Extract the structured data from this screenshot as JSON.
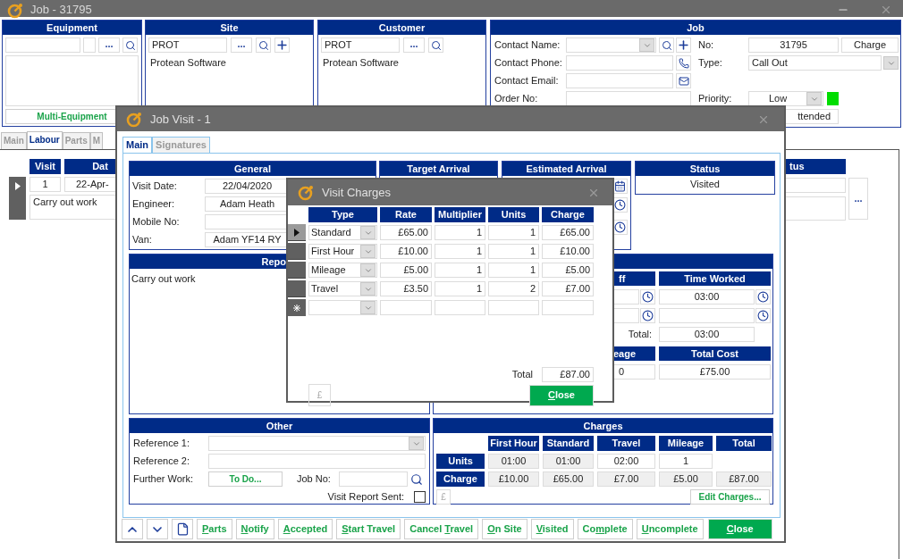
{
  "job_window": {
    "title": "Job - 31795",
    "equipment": {
      "title": "Equipment",
      "more_button": "...",
      "multi_button": "Multi-Equipment"
    },
    "site": {
      "title": "Site",
      "code": "PROT",
      "more_button": "...",
      "name": "Protean Software"
    },
    "customer": {
      "title": "Customer",
      "code": "PROT",
      "more_button": "...",
      "name": "Protean Software"
    },
    "job": {
      "title": "Job",
      "contact_name_label": "Contact Name:",
      "contact_phone_label": "Contact Phone:",
      "contact_email_label": "Contact Email:",
      "order_no_label": "Order No:",
      "no_label": "No:",
      "no": "31795",
      "charge_button": "Charge",
      "type_label": "Type:",
      "type": "Call Out",
      "priority_label": "Priority:",
      "priority": {
        "value": "Low",
        "color": "#00dd00"
      },
      "status": "ttended"
    },
    "tabs": [
      {
        "label": "Main",
        "selected": false
      },
      {
        "label": "Labour",
        "selected": true
      },
      {
        "label": "Parts",
        "selected": false
      },
      {
        "label": "M",
        "selected": false
      }
    ],
    "labour_grid": {
      "columns": [
        "Visit",
        "Dat"
      ],
      "rows": [
        {
          "visit": "1",
          "date": "22-Apr-",
          "description": "Carry out work",
          "selected": true
        }
      ],
      "right_header": "tus",
      "more_button": "..."
    }
  },
  "job_visit": {
    "title": "Job Visit - 1",
    "tabs": [
      {
        "label": "Main",
        "selected": true
      },
      {
        "label": "Signatures",
        "selected": false
      }
    ],
    "general": {
      "title": "General",
      "rows": [
        {
          "label": "Visit Date:",
          "value": "22/04/2020"
        },
        {
          "label": "Engineer:",
          "value": "Adam Heath"
        },
        {
          "label": "Mobile No:"
        },
        {
          "label": "Van:",
          "value": "Adam YF14 RY"
        }
      ]
    },
    "target_arrival": {
      "title": "Target Arrival"
    },
    "estimated_arrival": {
      "title": "Estimated Arrival"
    },
    "status": {
      "title": "Status",
      "value": "Visited"
    },
    "report": {
      "title": "Repo",
      "text": "Carry out work"
    },
    "times": {
      "time_off_header": "ff",
      "time_worked_header": "Time Worked",
      "time_worked": "03:00",
      "total_label": "Total:",
      "total": "03:00",
      "mileage_header": "eage",
      "total_cost_header": "Total Cost",
      "mileage": "0",
      "total_cost": "£75.00"
    },
    "other": {
      "title": "Other",
      "reference1_label": "Reference 1:",
      "reference2_label": "Reference 2:",
      "further_work_label": "Further Work:",
      "further_work_button": "To Do...",
      "job_no_label": "Job No:",
      "report_sent_label": "Visit Report Sent:",
      "report_sent": false
    },
    "charges": {
      "title": "Charges",
      "columns": [
        "First Hour",
        "Standard",
        "Travel",
        "Mileage",
        "Total"
      ],
      "rows": [
        {
          "label": "Units",
          "cells": [
            {
              "value": "01:00",
              "readonly": true
            },
            {
              "value": "01:00",
              "readonly": true
            },
            {
              "value": "02:00",
              "readonly": false
            },
            {
              "value": "1",
              "readonly": false
            }
          ]
        },
        {
          "label": "Charge",
          "cells": [
            {
              "value": "£10.00",
              "readonly": true
            },
            {
              "value": "£65.00",
              "readonly": true
            },
            {
              "value": "£7.00",
              "readonly": true
            },
            {
              "value": "£5.00",
              "readonly": true
            },
            {
              "value": "£87.00",
              "readonly": true
            }
          ]
        }
      ],
      "currency_button": "£",
      "edit_button": "Edit Charges..."
    },
    "toolbar": [
      {
        "kind": "up"
      },
      {
        "kind": "down"
      },
      {
        "kind": "document"
      },
      {
        "kind": "text",
        "key": "P",
        "post": "arts"
      },
      {
        "kind": "text",
        "key": "N",
        "post": "otify"
      },
      {
        "kind": "text",
        "key": "A",
        "post": "ccepted"
      },
      {
        "kind": "text",
        "key": "S",
        "post": "tart Travel"
      },
      {
        "kind": "text",
        "pre": "Cancel ",
        "key": "T",
        "post": "ravel"
      },
      {
        "kind": "text",
        "key": "O",
        "post": "n Site"
      },
      {
        "kind": "text",
        "key": "V",
        "post": "isited"
      },
      {
        "kind": "text",
        "pre": "Co",
        "key": "m",
        "post": "plete"
      },
      {
        "kind": "text",
        "key": "U",
        "post": "ncomplete"
      },
      {
        "kind": "primary",
        "key": "C",
        "post": "lose"
      }
    ]
  },
  "visit_charges": {
    "title": "Visit Charges",
    "columns": [
      "Type",
      "Rate",
      "Multiplier",
      "Units",
      "Charge"
    ],
    "rows": [
      {
        "type": "Standard",
        "rate": "£65.00",
        "multiplier": "1",
        "units": "1",
        "charge": "£65.00",
        "selected": true
      },
      {
        "type": "First Hour",
        "rate": "£10.00",
        "multiplier": "1",
        "units": "1",
        "charge": "£10.00",
        "selected": false
      },
      {
        "type": "Mileage",
        "rate": "£5.00",
        "multiplier": "1",
        "units": "1",
        "charge": "£5.00",
        "selected": false
      },
      {
        "type": "Travel",
        "rate": "£3.50",
        "multiplier": "1",
        "units": "2",
        "charge": "£7.00",
        "selected": false
      }
    ],
    "total_label": "Total",
    "total": "£87.00",
    "currency_button": "£",
    "close_button": {
      "key": "C",
      "post": "lose"
    }
  }
}
